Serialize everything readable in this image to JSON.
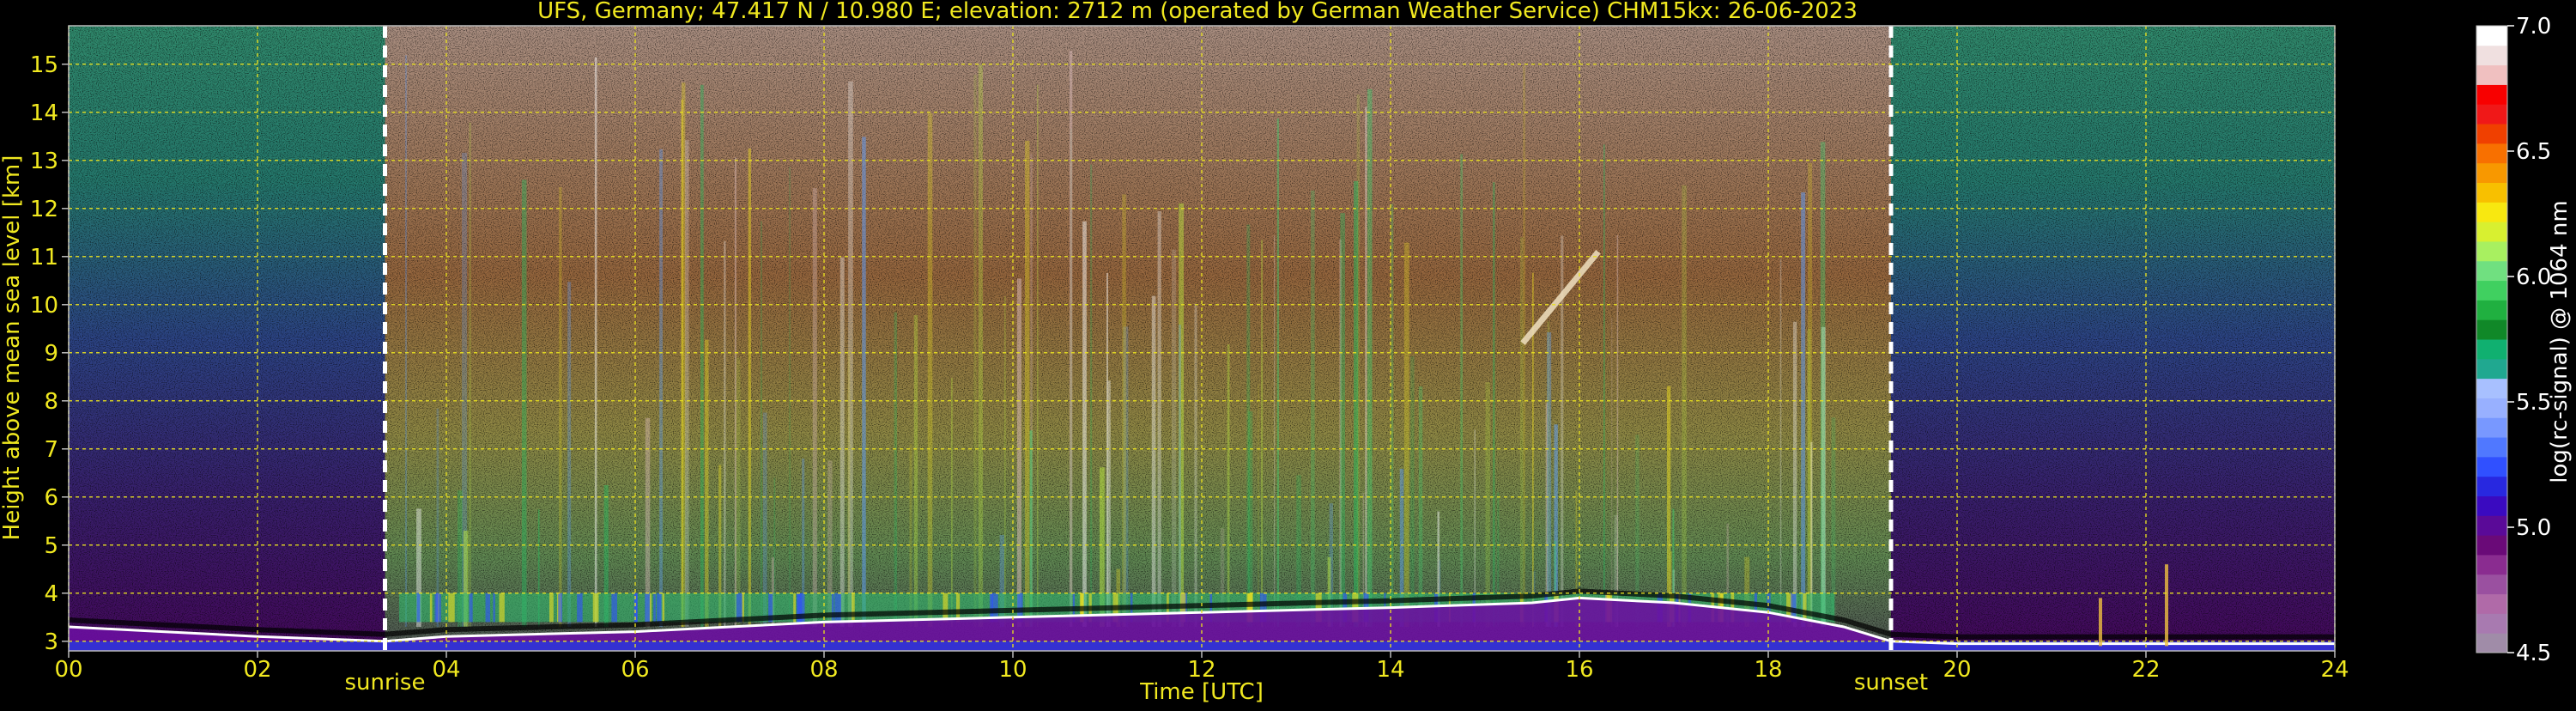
{
  "chart_data": {
    "type": "heatmap",
    "title": "UFS, Germany; 47.417 N / 10.980 E; elevation: 2712 m  (operated by German Weather Service)    CHM15kx: 26-06-2023",
    "xlabel": "Time [UTC]",
    "ylabel": "Height above mean sea level [km]",
    "xlim": [
      0,
      24
    ],
    "ylim": [
      2.8,
      15.8
    ],
    "x_ticks": [
      "00",
      "02",
      "04",
      "06",
      "08",
      "10",
      "12",
      "14",
      "16",
      "18",
      "20",
      "22",
      "24"
    ],
    "y_ticks": [
      "3",
      "4",
      "5",
      "6",
      "7",
      "8",
      "9",
      "10",
      "11",
      "12",
      "13",
      "14",
      "15"
    ],
    "grid": true,
    "markers": [
      {
        "label": "sunrise",
        "x": 3.35
      },
      {
        "label": "sunset",
        "x": 19.3
      }
    ],
    "colorbar": {
      "label": "log(rc-signal) @ 1064 nm",
      "range": [
        4.5,
        7.0
      ],
      "ticks": [
        "4.5",
        "5.0",
        "5.5",
        "6.0",
        "6.5",
        "7.0"
      ],
      "colors": [
        "#a08ca8",
        "#a87ab0",
        "#b06aa8",
        "#9a50a0",
        "#8a2c90",
        "#6a0a78",
        "#5a0a98",
        "#3a0ac0",
        "#2828e0",
        "#3050ff",
        "#5078ff",
        "#7898ff",
        "#98b0ff",
        "#a8c0ff",
        "#20a890",
        "#10b070",
        "#108828",
        "#20b040",
        "#40d060",
        "#70e080",
        "#a8f060",
        "#d8f030",
        "#f8e810",
        "#f8c000",
        "#f89800",
        "#f87000",
        "#f04000",
        "#f01818",
        "#f80000",
        "#f0c0c0",
        "#f0e0e0",
        "#ffffff"
      ]
    },
    "boundary_layer_top_km": [
      {
        "x": 0.0,
        "y": 3.3
      },
      {
        "x": 1.0,
        "y": 3.2
      },
      {
        "x": 2.0,
        "y": 3.1
      },
      {
        "x": 3.35,
        "y": 3.0
      },
      {
        "x": 4.0,
        "y": 3.1
      },
      {
        "x": 6.0,
        "y": 3.2
      },
      {
        "x": 8.0,
        "y": 3.4
      },
      {
        "x": 10.0,
        "y": 3.5
      },
      {
        "x": 12.0,
        "y": 3.6
      },
      {
        "x": 14.0,
        "y": 3.7
      },
      {
        "x": 15.5,
        "y": 3.8
      },
      {
        "x": 16.0,
        "y": 3.9
      },
      {
        "x": 17.0,
        "y": 3.8
      },
      {
        "x": 18.0,
        "y": 3.6
      },
      {
        "x": 18.8,
        "y": 3.3
      },
      {
        "x": 19.3,
        "y": 3.0
      },
      {
        "x": 20.0,
        "y": 2.95
      },
      {
        "x": 24.0,
        "y": 2.95
      }
    ],
    "aerosol_layer_km": {
      "x_start": 3.5,
      "x_end": 18.7,
      "y_bottom": 3.4,
      "y_top": 4.0
    },
    "cirrus_km": {
      "x_start": 15.4,
      "x_end": 16.2,
      "y_bottom": 9.2,
      "y_top": 11.1
    }
  }
}
